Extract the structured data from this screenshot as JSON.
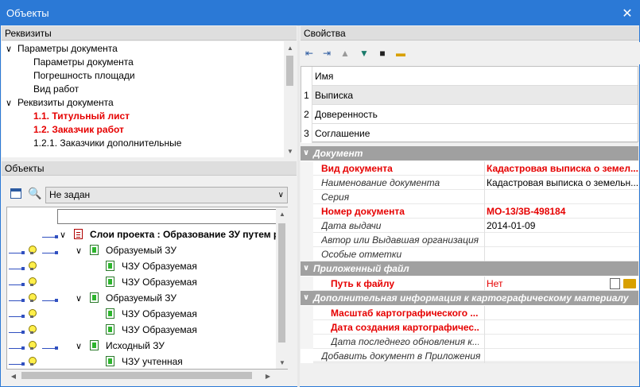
{
  "window": {
    "title": "Объекты",
    "close_glyph": "✕"
  },
  "left": {
    "rekvizity_header": "Реквизиты",
    "tree": [
      {
        "label": "Параметры документа",
        "level": 0,
        "expanded": true,
        "red": false
      },
      {
        "label": "Параметры документа",
        "level": 1,
        "red": false
      },
      {
        "label": "Погрешность площади",
        "level": 1,
        "red": false
      },
      {
        "label": "Вид работ",
        "level": 1,
        "red": false
      },
      {
        "label": "Реквизиты документа",
        "level": 0,
        "expanded": true,
        "red": false
      },
      {
        "label": "1.1. Титульный лист",
        "level": 1,
        "red": true
      },
      {
        "label": "1.2. Заказчик работ",
        "level": 1,
        "red": true
      },
      {
        "label": "1.2.1. Заказчики дополнительные",
        "level": 1,
        "red": false
      }
    ],
    "objects_header": "Объекты",
    "select_value": "Не задан",
    "objects_tree": [
      {
        "label": "Слои проекта : Образование ЗУ путем ра",
        "kind": "root"
      },
      {
        "label": "Образуемый ЗУ",
        "kind": "group"
      },
      {
        "label": "ЧЗУ Образуемая",
        "kind": "item"
      },
      {
        "label": "ЧЗУ Образуемая",
        "kind": "item"
      },
      {
        "label": "Образуемый ЗУ",
        "kind": "group"
      },
      {
        "label": "ЧЗУ Образуемая",
        "kind": "item"
      },
      {
        "label": "ЧЗУ Образуемая",
        "kind": "item"
      },
      {
        "label": "Исходный ЗУ",
        "kind": "group"
      },
      {
        "label": "ЧЗУ учтенная",
        "kind": "item"
      }
    ]
  },
  "right": {
    "props_header": "Свойства",
    "grid_header": "Имя",
    "rows": [
      {
        "num": "1",
        "name": "Выписка"
      },
      {
        "num": "2",
        "name": "Доверенность"
      },
      {
        "num": "3",
        "name": "Соглашение"
      }
    ],
    "categories": {
      "doc": "Документ",
      "file": "Приложенный файл",
      "extra": "Дополнительная информация к картографическому материалу"
    },
    "doc_props": [
      {
        "key": "Вид документа",
        "value": "Кадастровая выписка о земел...",
        "key_red": true,
        "val_red": true
      },
      {
        "key": "Наименование документа",
        "value": "Кадастровая выписка о земельн...",
        "key_red": false,
        "val_red": false
      },
      {
        "key": "Серия",
        "value": "",
        "key_red": false,
        "val_red": false
      },
      {
        "key": "Номер документа",
        "value": "МО-13/3В-498184",
        "key_red": true,
        "val_red": true
      },
      {
        "key": "Дата выдачи",
        "value": "2014-01-09",
        "key_red": false,
        "val_red": false
      },
      {
        "key": "Автор или Выдавшая организация",
        "value": "",
        "key_red": false,
        "val_red": false
      },
      {
        "key": "Особые отметки",
        "value": "",
        "key_red": false,
        "val_red": false
      }
    ],
    "file_prop": {
      "key": "Путь к файлу",
      "value": "Нет"
    },
    "extra_props": [
      {
        "key": "Масштаб картографического ...",
        "value": "",
        "red": true
      },
      {
        "key": "Дата создания картографичес...",
        "value": "",
        "red": true
      },
      {
        "key": "Дата последнего обновления к...",
        "value": "",
        "red": false
      }
    ],
    "add_doc": "Добавить документ в Приложения"
  }
}
